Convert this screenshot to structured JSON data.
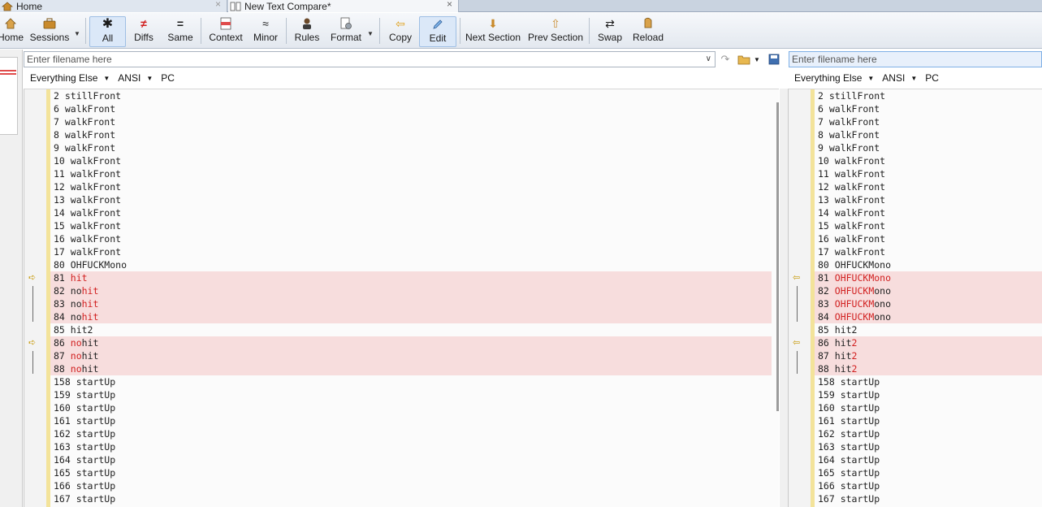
{
  "tabs": [
    {
      "label": "Home",
      "close": "×"
    },
    {
      "label": "New Text Compare*",
      "close": "×"
    }
  ],
  "toolbar": {
    "home": "Home",
    "sessions": "Sessions",
    "all": "All",
    "diffs": "Diffs",
    "same": "Same",
    "context": "Context",
    "minor": "Minor",
    "rules": "Rules",
    "format": "Format",
    "copy": "Copy",
    "edit": "Edit",
    "next_section": "Next Section",
    "prev_section": "Prev Section",
    "swap": "Swap",
    "reload": "Reload"
  },
  "left_file": {
    "placeholder": "Enter filename here"
  },
  "right_file": {
    "placeholder": "Enter filename here"
  },
  "left_format": {
    "ruleset": "Everything Else",
    "encoding": "ANSI",
    "line_endings": "PC"
  },
  "right_format": {
    "ruleset": "Everything Else",
    "encoding": "ANSI",
    "line_endings": "PC"
  },
  "colors": {
    "diff_bg": "#f7dddd",
    "diff_text": "#d11f1f",
    "gutter_bar": "#f3e39a",
    "marker": "#c79a0c"
  },
  "left_lines": [
    [
      {
        "t": "2 stillFront"
      }
    ],
    [
      {
        "t": "6 walkFront"
      }
    ],
    [
      {
        "t": "7 walkFront"
      }
    ],
    [
      {
        "t": "8 walkFront"
      }
    ],
    [
      {
        "t": "9 walkFront"
      }
    ],
    [
      {
        "t": "10 walkFront"
      }
    ],
    [
      {
        "t": "11 walkFront"
      }
    ],
    [
      {
        "t": "12 walkFront"
      }
    ],
    [
      {
        "t": "13 walkFront"
      }
    ],
    [
      {
        "t": "14 walkFront"
      }
    ],
    [
      {
        "t": "15 walkFront"
      }
    ],
    [
      {
        "t": "16 walkFront"
      }
    ],
    [
      {
        "t": "17 walkFront"
      }
    ],
    [
      {
        "t": "80 OHFUCKMono"
      }
    ],
    [
      {
        "t": "81 "
      },
      {
        "t": "hit",
        "red": true
      }
    ],
    [
      {
        "t": "82 no"
      },
      {
        "t": "hit",
        "red": true
      }
    ],
    [
      {
        "t": "83 no"
      },
      {
        "t": "hit",
        "red": true
      }
    ],
    [
      {
        "t": "84 no"
      },
      {
        "t": "hit",
        "red": true
      }
    ],
    [
      {
        "t": "85 hit2"
      }
    ],
    [
      {
        "t": "86 "
      },
      {
        "t": "no",
        "red": true
      },
      {
        "t": "hit"
      }
    ],
    [
      {
        "t": "87 "
      },
      {
        "t": "no",
        "red": true
      },
      {
        "t": "hit"
      }
    ],
    [
      {
        "t": "88 "
      },
      {
        "t": "no",
        "red": true
      },
      {
        "t": "hit"
      }
    ],
    [
      {
        "t": "158 startUp"
      }
    ],
    [
      {
        "t": "159 startUp"
      }
    ],
    [
      {
        "t": "160 startUp"
      }
    ],
    [
      {
        "t": "161 startUp"
      }
    ],
    [
      {
        "t": "162 startUp"
      }
    ],
    [
      {
        "t": "163 startUp"
      }
    ],
    [
      {
        "t": "164 startUp"
      }
    ],
    [
      {
        "t": "165 startUp"
      }
    ],
    [
      {
        "t": "166 startUp"
      }
    ],
    [
      {
        "t": "167 startUp"
      }
    ]
  ],
  "right_lines": [
    [
      {
        "t": "2 stillFront"
      }
    ],
    [
      {
        "t": "6 walkFront"
      }
    ],
    [
      {
        "t": "7 walkFront"
      }
    ],
    [
      {
        "t": "8 walkFront"
      }
    ],
    [
      {
        "t": "9 walkFront"
      }
    ],
    [
      {
        "t": "10 walkFront"
      }
    ],
    [
      {
        "t": "11 walkFront"
      }
    ],
    [
      {
        "t": "12 walkFront"
      }
    ],
    [
      {
        "t": "13 walkFront"
      }
    ],
    [
      {
        "t": "14 walkFront"
      }
    ],
    [
      {
        "t": "15 walkFront"
      }
    ],
    [
      {
        "t": "16 walkFront"
      }
    ],
    [
      {
        "t": "17 walkFront"
      }
    ],
    [
      {
        "t": "80 OHFUCKMono"
      }
    ],
    [
      {
        "t": "81 "
      },
      {
        "t": "OHFUCKMono",
        "red": true
      }
    ],
    [
      {
        "t": "82 "
      },
      {
        "t": "OHFUCKM",
        "red": true
      },
      {
        "t": "ono"
      }
    ],
    [
      {
        "t": "83 "
      },
      {
        "t": "OHFUCKM",
        "red": true
      },
      {
        "t": "ono"
      }
    ],
    [
      {
        "t": "84 "
      },
      {
        "t": "OHFUCKM",
        "red": true
      },
      {
        "t": "ono"
      }
    ],
    [
      {
        "t": "85 hit2"
      }
    ],
    [
      {
        "t": "86 hit"
      },
      {
        "t": "2",
        "red": true
      }
    ],
    [
      {
        "t": "87 hit"
      },
      {
        "t": "2",
        "red": true
      }
    ],
    [
      {
        "t": "88 hit"
      },
      {
        "t": "2",
        "red": true
      }
    ],
    [
      {
        "t": "158 startUp"
      }
    ],
    [
      {
        "t": "159 startUp"
      }
    ],
    [
      {
        "t": "160 startUp"
      }
    ],
    [
      {
        "t": "161 startUp"
      }
    ],
    [
      {
        "t": "162 startUp"
      }
    ],
    [
      {
        "t": "163 startUp"
      }
    ],
    [
      {
        "t": "164 startUp"
      }
    ],
    [
      {
        "t": "165 startUp"
      }
    ],
    [
      {
        "t": "166 startUp"
      }
    ],
    [
      {
        "t": "167 startUp"
      }
    ]
  ]
}
